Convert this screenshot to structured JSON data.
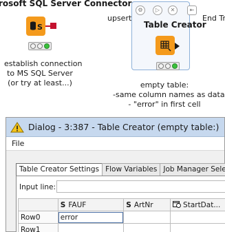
{
  "canvas": {
    "left_node": {
      "title": "rosoft SQL Server Connector",
      "annotation": [
        "establish connection",
        "to MS SQL Server",
        "(or try at least...)"
      ]
    },
    "selected_node": {
      "title": "Table Creator",
      "annotation": [
        "empty table:",
        "-same column names as data",
        "- \"error\" in first cell"
      ]
    },
    "upsert_label": "upsert data",
    "end_label": "End Try"
  },
  "dialog": {
    "title": "Dialog - 3:387 - Table Creator (empty table:)",
    "menu": [
      "File"
    ],
    "tabs": [
      {
        "label": "Table Creator Settings",
        "active": true
      },
      {
        "label": "Flow Variables",
        "active": false
      },
      {
        "label": "Job Manager Selection",
        "active": false
      }
    ],
    "input_line_label": "Input line:",
    "input_line_value": "",
    "columns": [
      {
        "type": "S",
        "name": "FAUF"
      },
      {
        "type": "S",
        "name": "ArtNr"
      },
      {
        "type": "date",
        "name": "StartDat..."
      }
    ],
    "rows": [
      {
        "id": "Row0",
        "cells": [
          "error",
          "",
          ""
        ]
      },
      {
        "id": "Row1",
        "cells": [
          "",
          "",
          ""
        ]
      }
    ]
  },
  "colors": {
    "node_orange": "#f49a1c",
    "titlebar": "#c6d8ee",
    "connector_red": "#c4122f",
    "status_green": "#39c13a"
  },
  "icons": {
    "db_node": "database-icon",
    "table_node": "table-grid-icon",
    "warning": "warning-triangle-icon"
  }
}
